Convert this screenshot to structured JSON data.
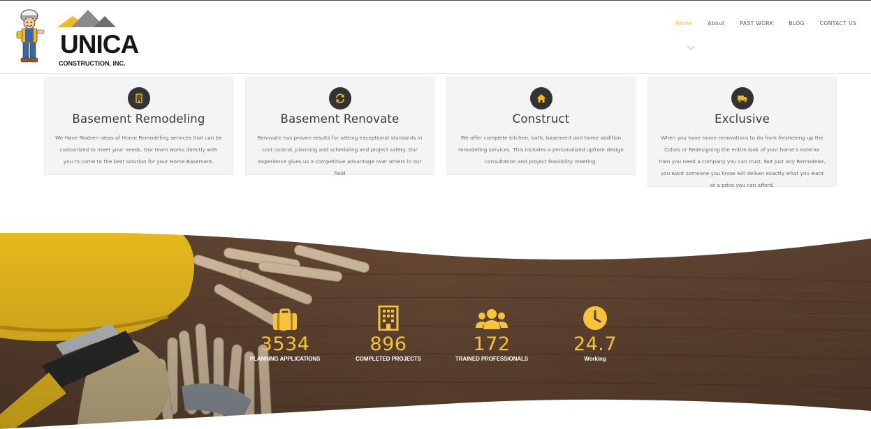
{
  "brand": {
    "name": "UNICA",
    "subtitle": "CONSTRUCTION, INC."
  },
  "nav": {
    "items": [
      {
        "label": "Home",
        "active": true
      },
      {
        "label": "About",
        "active": false
      },
      {
        "label": "PAST WORK",
        "active": false
      },
      {
        "label": "BLOG",
        "active": false
      },
      {
        "label": "CONTACT US",
        "active": false
      }
    ]
  },
  "services": [
    {
      "icon": "building-icon",
      "title": "Basement Remodeling",
      "text": "We Have Modren ideas of Home Remodeling services that can be customized to meet your needs. Our team works directly with you to come to the best solution for your Home Basement."
    },
    {
      "icon": "refresh-icon",
      "title": "Basement Renovate",
      "text": "Renovate has proven results for setting exceptional standards in cost control, planning and scheduling and project safety. Our experience gives us a competitive advantage over others in our field"
    },
    {
      "icon": "home-icon",
      "title": "Construct",
      "text": "We offer complete kitchen, bath, basement and home addition remodeling services. This includes a personalized upfront design consultation and project feasibility meeting."
    },
    {
      "icon": "truck-icon",
      "title": "Exclusive",
      "text": "When you have home renovations to do from freshening up the Colors or Redesigning the entire look of your home's exterior then you need a company you can trust. Not Just any Remodeler, you want someone you know will deliver exactly what you want at a price you can afford."
    }
  ],
  "stats": [
    {
      "icon": "briefcase-icon",
      "value": "3534",
      "label": "PLANNING APPLICATIONS"
    },
    {
      "icon": "building-icon",
      "value": "896",
      "label": "COMPLETED PROJECTS"
    },
    {
      "icon": "users-icon",
      "value": "172",
      "label": "TRAINED PROFESSIONALS"
    },
    {
      "icon": "clock-icon",
      "value": "24.7",
      "label": "Working"
    }
  ],
  "colors": {
    "accent": "#f2b824",
    "stat_number": "#f6c33b",
    "card_bg": "#f4f4f4",
    "icon_circle": "#333333"
  }
}
